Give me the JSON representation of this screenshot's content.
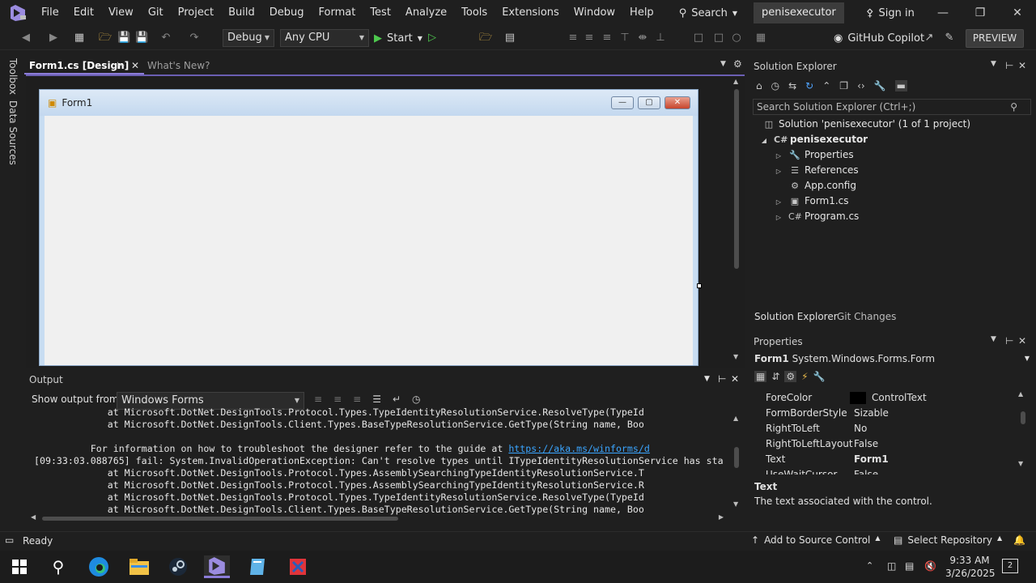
{
  "menu": {
    "items": [
      "File",
      "Edit",
      "View",
      "Git",
      "Project",
      "Build",
      "Debug",
      "Format",
      "Test",
      "Analyze",
      "Tools",
      "Extensions",
      "Window",
      "Help"
    ],
    "search_label": "Search",
    "solution_name": "penisexecutor",
    "signin_label": "Sign in"
  },
  "toolbar": {
    "configuration": "Debug",
    "platform": "Any CPU",
    "start_label": "Start",
    "copilot_label": "GitHub Copilot",
    "preview_label": "PREVIEW"
  },
  "left_tabs": [
    "Toolbox",
    "Data Sources"
  ],
  "doc_tabs": {
    "active": "Form1.cs [Design]",
    "inactive": "What's New?"
  },
  "designer": {
    "form_title": "Form1"
  },
  "solution_explorer": {
    "title": "Solution Explorer",
    "search_placeholder": "Search Solution Explorer (Ctrl+;)",
    "solution_node": "Solution 'penisexecutor' (1 of 1 project)",
    "project_node": "penisexecutor",
    "items": [
      {
        "label": "Properties",
        "icon": "wrench-icon",
        "expandable": true
      },
      {
        "label": "References",
        "icon": "references-icon",
        "expandable": true
      },
      {
        "label": "App.config",
        "icon": "config-file-icon",
        "expandable": false
      },
      {
        "label": "Form1.cs",
        "icon": "form-icon",
        "expandable": true
      },
      {
        "label": "Program.cs",
        "icon": "csharp-file-icon",
        "expandable": true
      }
    ],
    "bottom_tabs": [
      "Solution Explorer",
      "Git Changes"
    ]
  },
  "properties": {
    "title": "Properties",
    "object_name": "Form1",
    "object_type": "System.Windows.Forms.Form",
    "rows": [
      {
        "name": "ForeColor",
        "value": "ControlText",
        "swatch": "#000000",
        "bold": false
      },
      {
        "name": "FormBorderStyle",
        "value": "Sizable",
        "bold": false
      },
      {
        "name": "RightToLeft",
        "value": "No",
        "bold": false
      },
      {
        "name": "RightToLeftLayout",
        "value": "False",
        "bold": false
      },
      {
        "name": "Text",
        "value": "Form1",
        "bold": true
      },
      {
        "name": "UseWaitCursor",
        "value": "False",
        "bold": false
      }
    ],
    "desc_title": "Text",
    "desc_text": "The text associated with the control."
  },
  "output": {
    "title": "Output",
    "show_from_label": "Show output from:",
    "source": "Windows Forms",
    "lines": [
      "             at Microsoft.DotNet.DesignTools.Protocol.Types.TypeIdentityResolutionService.ResolveType(TypeId",
      "             at Microsoft.DotNet.DesignTools.Client.Types.BaseTypeResolutionService.GetType(String name, Boo",
      "",
      "          For information on how to troubleshoot the designer refer to the guide at ",
      "[09:33:03.088765] fail: System.InvalidOperationException: Can't resolve types until ITypeIdentityResolutionService has sta",
      "             at Microsoft.DotNet.DesignTools.Protocol.Types.AssemblySearchingTypeIdentityResolutionService.T",
      "             at Microsoft.DotNet.DesignTools.Protocol.Types.AssemblySearchingTypeIdentityResolutionService.R",
      "             at Microsoft.DotNet.DesignTools.Protocol.Types.TypeIdentityResolutionService.ResolveType(TypeId",
      "             at Microsoft.DotNet.DesignTools.Client.Types.BaseTypeResolutionService.GetType(String name, Boo"
    ],
    "link": "https://aka.ms/winforms/d"
  },
  "status": {
    "ready": "Ready",
    "source_control": "Add to Source Control",
    "repository": "Select Repository"
  },
  "taskbar": {
    "time": "9:33 AM",
    "date": "3/26/2025",
    "notification_count": "2"
  }
}
